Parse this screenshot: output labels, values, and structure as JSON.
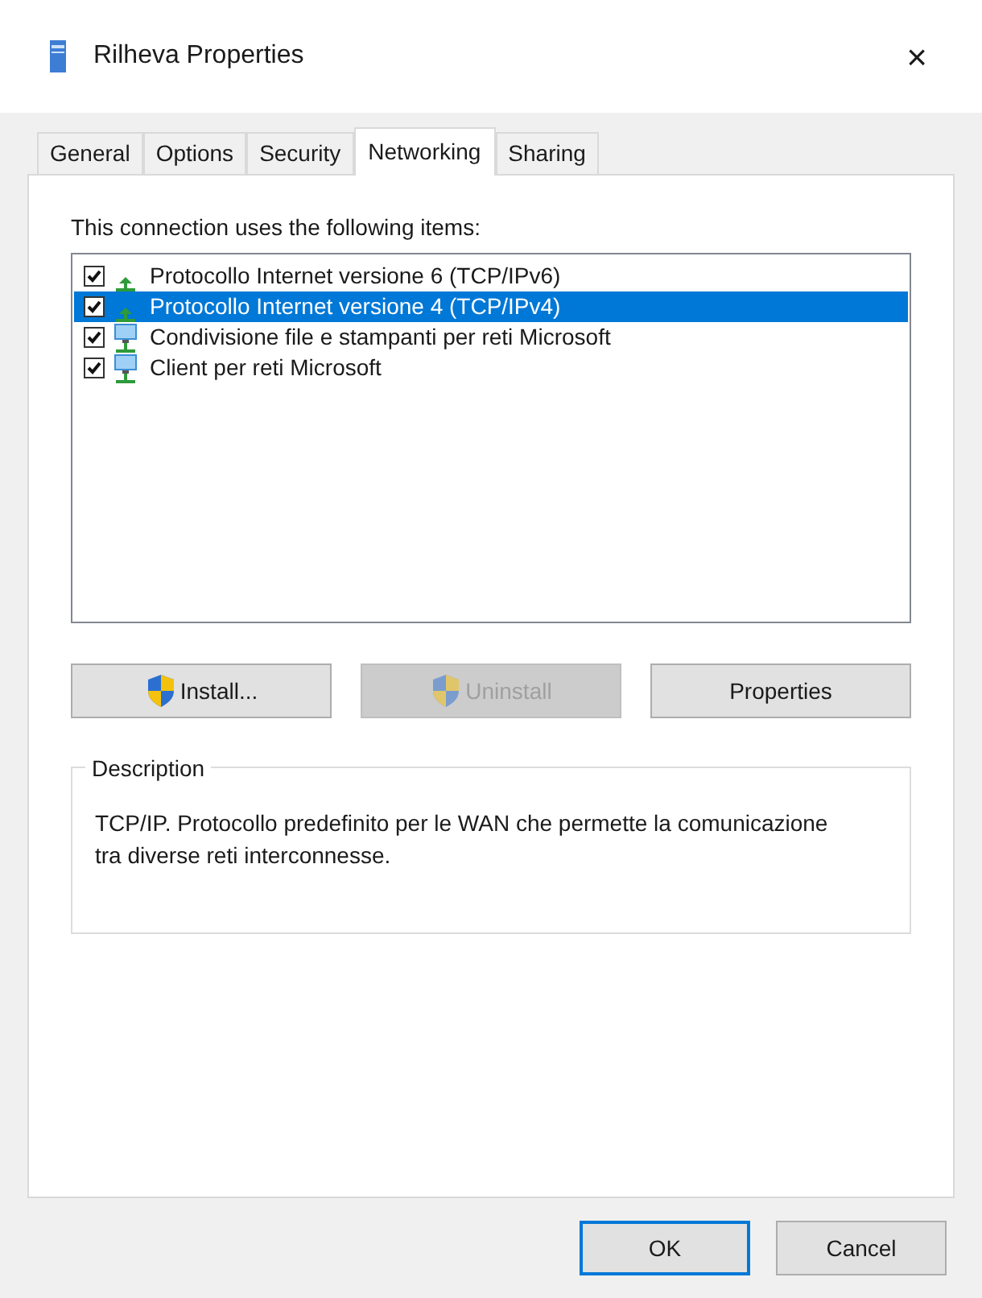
{
  "window": {
    "title": "Rilheva Properties",
    "close": "×"
  },
  "tabs": [
    {
      "label": "General",
      "selected": false
    },
    {
      "label": "Options",
      "selected": false
    },
    {
      "label": "Security",
      "selected": false
    },
    {
      "label": "Networking",
      "selected": true
    },
    {
      "label": "Sharing",
      "selected": false
    }
  ],
  "items_label": "This connection uses the following items:",
  "items": [
    {
      "label": "Protocollo Internet versione 6 (TCP/IPv6)",
      "kind": "protocol",
      "checked": true,
      "selected": false
    },
    {
      "label": "Protocollo Internet versione 4 (TCP/IPv4)",
      "kind": "protocol",
      "checked": true,
      "selected": true
    },
    {
      "label": "Condivisione file e stampanti per reti Microsoft",
      "kind": "service",
      "checked": true,
      "selected": false
    },
    {
      "label": "Client per reti Microsoft",
      "kind": "client",
      "checked": true,
      "selected": false
    }
  ],
  "buttons": [
    {
      "label": "Install...",
      "shield": true,
      "disabled": false
    },
    {
      "label": "Uninstall",
      "shield": true,
      "disabled": true
    },
    {
      "label": "Properties",
      "shield": false,
      "disabled": false
    }
  ],
  "description": {
    "title": "Description",
    "text": "TCP/IP. Protocollo predefinito per le WAN che permette la comunicazione tra diverse reti interconnesse."
  },
  "footer_buttons": [
    {
      "label": "OK",
      "default": true
    },
    {
      "label": "Cancel",
      "default": false
    }
  ]
}
